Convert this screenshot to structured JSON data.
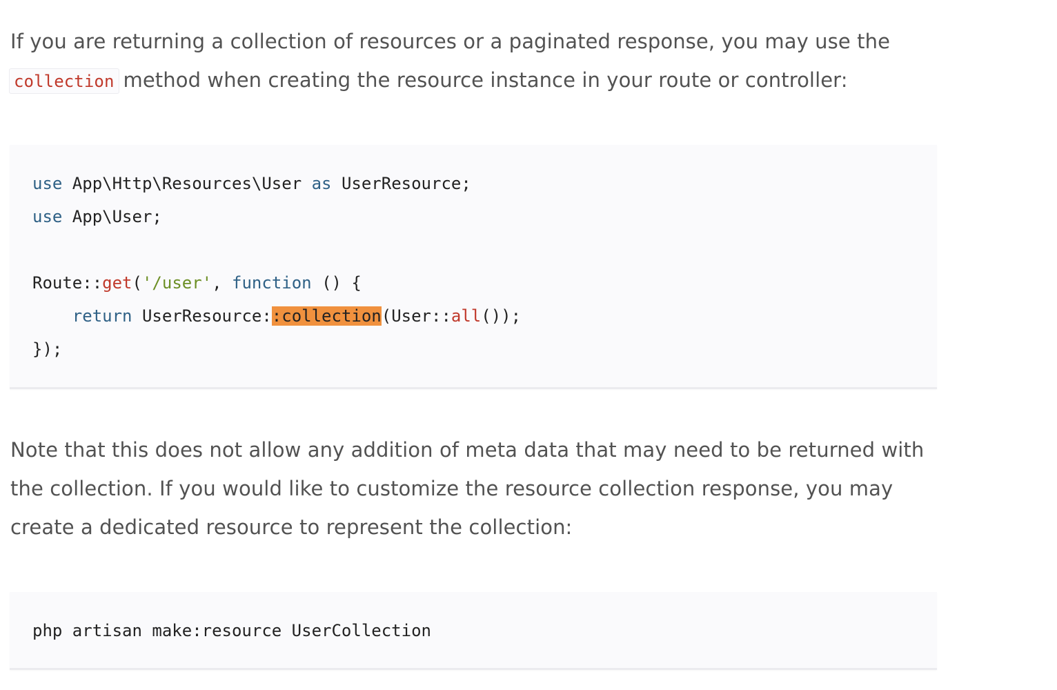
{
  "paragraph_1": {
    "before_code": "If you are returning a collection of resources or a paginated response, you may use the",
    "inline_code": "collection",
    "after_code": "method when creating the resource instance in your route or controller:"
  },
  "code_block_1": {
    "line_1": {
      "kw_use": "use",
      "path": " App\\Http\\Resources\\User ",
      "kw_as": "as",
      "alias": " UserResource;"
    },
    "line_2": {
      "kw_use": "use",
      "path": " App\\User;"
    },
    "line_4": {
      "route": "Route::",
      "method": "get",
      "open": "(",
      "url": "'/user'",
      "comma": ", ",
      "kw_function": "function",
      "rest": " () {"
    },
    "line_5": {
      "indent": "    ",
      "kw_return": "return",
      "class": " UserResource:",
      "highlight": ":collection",
      "args_open": "(User::",
      "all_fn": "all",
      "args_close": "());"
    },
    "line_6": {
      "close": "});"
    }
  },
  "paragraph_2": {
    "text": "Note that this does not allow any addition of meta data that may need to be returned with the collection. If you would like to customize the resource collection response, you may create a dedicated resource to represent the collection:"
  },
  "code_block_2": {
    "command": "php artisan make:resource UserCollection"
  },
  "colors": {
    "text": "#525252",
    "code_text": "#222222",
    "keyword": "#2f6186",
    "function": "#c0392b",
    "string": "#6c8f25",
    "highlight": "#f0913e",
    "code_background": "#fafafc"
  }
}
